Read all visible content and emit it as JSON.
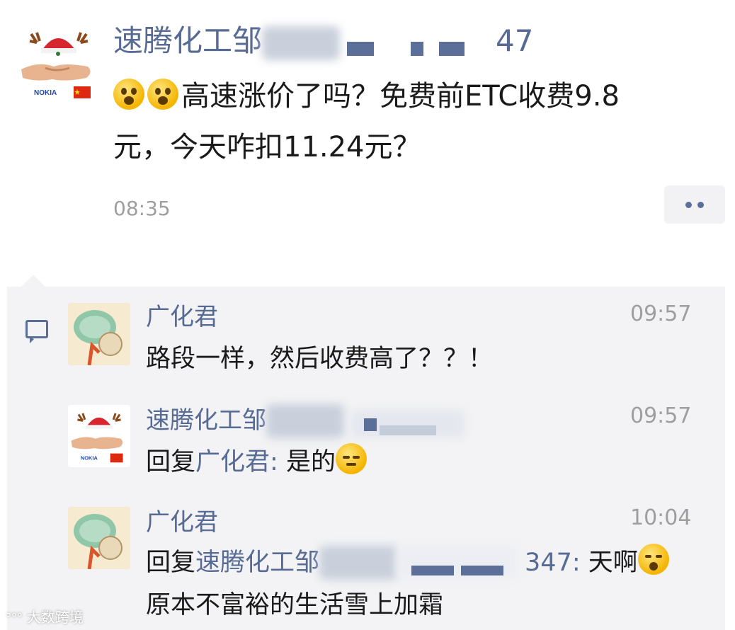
{
  "post": {
    "author_visible": "速腾化工邹",
    "author_tail": "47",
    "avatar_badge": "NOKIA",
    "text_line1": "高速涨价了吗？免费前ETC收费9.8",
    "text_line2": "元，今天咋扣11.24元？",
    "time": "08:35",
    "emoji_icons": [
      "astonished-emoji",
      "astonished-emoji"
    ]
  },
  "comments": [
    {
      "author": "广化君",
      "time": "09:57",
      "text": "路段一样，然后收费高了？？！"
    },
    {
      "author": "速腾化工邹",
      "time": "09:57",
      "reply_prefix": "回复",
      "reply_to": "广化君",
      "colon": ": ",
      "text": "是的",
      "emoji": "sweat-emoji"
    },
    {
      "author": "广化君",
      "time": "10:04",
      "reply_prefix": "回复",
      "reply_to": "速腾化工邹",
      "reply_tail": "347",
      "colon": ": ",
      "text": "天啊",
      "text_line2": "原本不富裕的生活雪上加霜",
      "emoji": "sigh-emoji"
    }
  ],
  "watermark": "大数跨境",
  "colors": {
    "link": "#576b95",
    "time": "#9e9e9e",
    "comment_bg": "#f3f3f5"
  }
}
